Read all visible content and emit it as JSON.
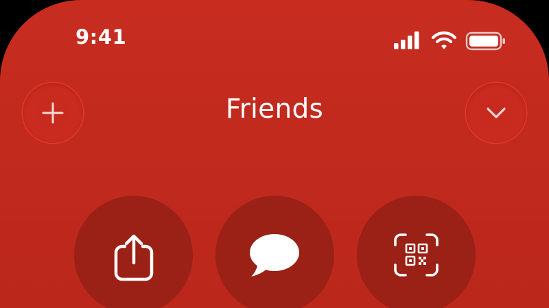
{
  "status_bar": {
    "time": "9:41",
    "icons": [
      "cellular-signal-icon",
      "wifi-icon",
      "battery-icon"
    ]
  },
  "header": {
    "title": "Friends",
    "left_button_icon": "plus-icon",
    "right_button_icon": "chevron-down-icon"
  },
  "actions": [
    {
      "icon": "share-icon"
    },
    {
      "icon": "message-bubble-icon"
    },
    {
      "icon": "qr-code-icon"
    }
  ],
  "colors": {
    "background": "#c42b1f",
    "action_button": "#9b2015",
    "foreground": "#ffffff",
    "button_ring": "#ff4632"
  }
}
